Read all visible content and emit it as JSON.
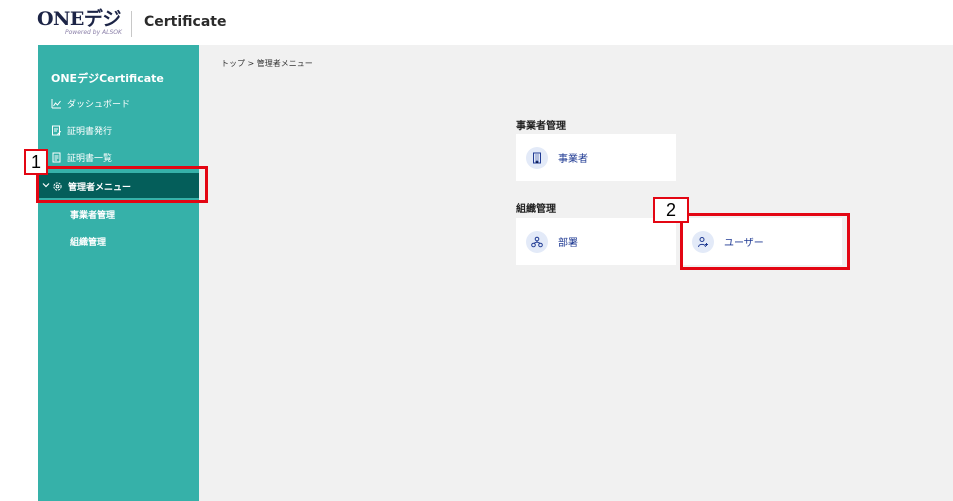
{
  "header": {
    "logo_text": "ONEデジ",
    "logo_sub": "Powered by ALSOK",
    "title": "Certificate"
  },
  "sidebar": {
    "title": "ONEデジCertificate",
    "items": [
      {
        "label": "ダッシュボード",
        "icon": "dashboard-icon"
      },
      {
        "label": "証明書発行",
        "icon": "document-edit-icon"
      },
      {
        "label": "証明書一覧",
        "icon": "document-list-icon"
      }
    ],
    "active_item": {
      "label": "管理者メニュー",
      "icon": "gear-icon"
    },
    "sub_items": [
      {
        "label": "事業者管理"
      },
      {
        "label": "組織管理"
      }
    ]
  },
  "main": {
    "breadcrumb": "トップ > 管理者メニュー",
    "sections": [
      {
        "title": "事業者管理",
        "cards": [
          {
            "label": "事業者",
            "icon": "building-icon"
          }
        ]
      },
      {
        "title": "組織管理",
        "cards": [
          {
            "label": "部署",
            "icon": "org-chart-icon"
          },
          {
            "label": "ユーザー",
            "icon": "add-user-icon"
          }
        ]
      }
    ]
  },
  "annotations": {
    "marker_1": "1",
    "marker_2": "2",
    "highlight_color": "#e30613"
  },
  "colors": {
    "sidebar_bg": "#36b1a9",
    "sidebar_active_bg": "#045e5a",
    "content_bg": "#f1f1f1",
    "card_label": "#1f3a93"
  }
}
